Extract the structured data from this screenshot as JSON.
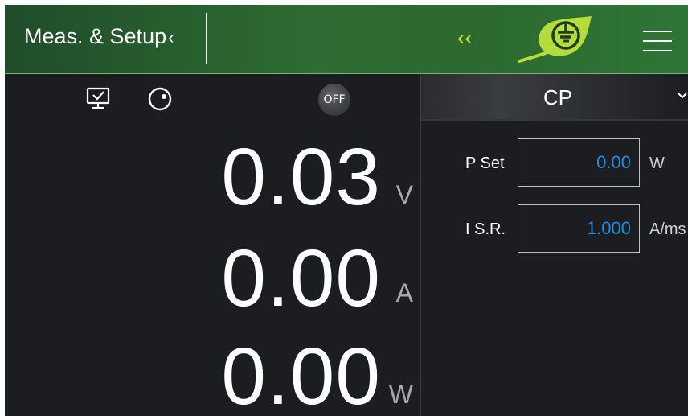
{
  "header": {
    "title": "Meas. & Setup",
    "title_chevron": "‹",
    "collapse_label": "‹‹",
    "logo_icon": "eco-leaf-logo",
    "menu_icon": "hamburger-menu-icon"
  },
  "status": {
    "monitor_icon": "monitor-icon",
    "knob_icon": "knob-icon",
    "output_state": "OFF"
  },
  "measurements": [
    {
      "value": "0.03",
      "unit": "V"
    },
    {
      "value": "0.00",
      "unit": "A"
    },
    {
      "value": "0.00",
      "unit": "W"
    }
  ],
  "mode": {
    "label": "CP"
  },
  "params": [
    {
      "label": "P Set",
      "value": "0.00",
      "unit": "W"
    },
    {
      "label": "I S.R.",
      "value": "1.000",
      "unit": "A/ms"
    }
  ],
  "colors": {
    "accent_value": "#1e8fe0",
    "collapse_arrows": "#cde036",
    "logo_leaf": "#b5dc3c"
  }
}
